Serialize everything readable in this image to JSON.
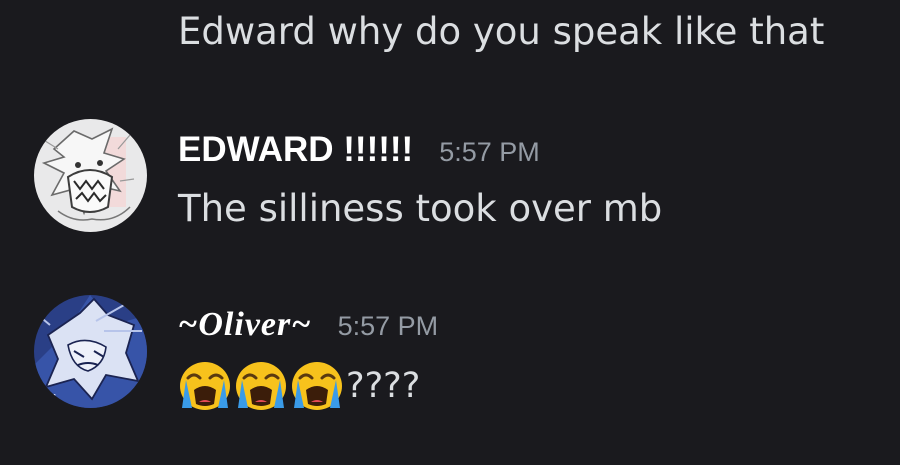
{
  "messages": {
    "m0": {
      "text": "Edward why do you speak like that"
    },
    "m1": {
      "username": "EDWARD !!!!!!",
      "timestamp": "5:57 PM",
      "text": "The silliness took over mb",
      "avatar_icon": "edward-avatar"
    },
    "m2": {
      "username": "~Oliver~",
      "timestamp": "5:57 PM",
      "emojis": [
        "loudly-crying-face",
        "loudly-crying-face",
        "loudly-crying-face"
      ],
      "text_tail": "????",
      "avatar_icon": "oliver-avatar"
    }
  },
  "colors": {
    "background": "#1a1a1e",
    "text": "#dbdee1",
    "username": "#ffffff",
    "timestamp": "#949ba4"
  }
}
